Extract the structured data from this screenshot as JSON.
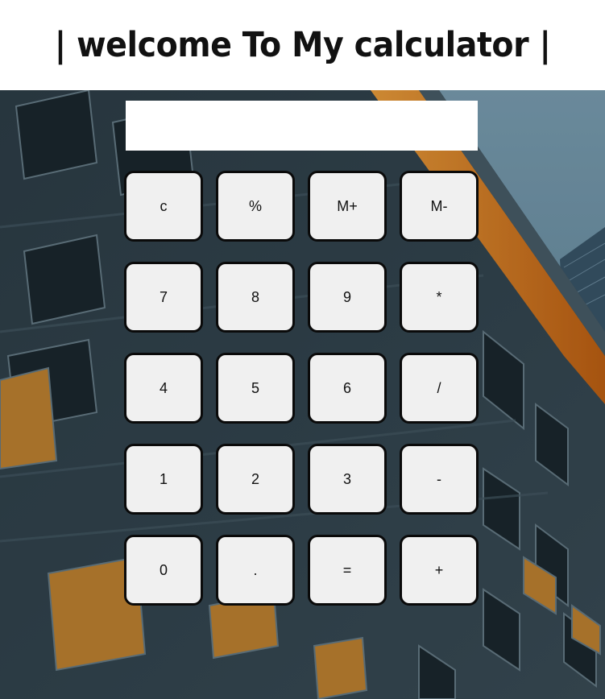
{
  "header": {
    "title": "| welcome To My calculator |"
  },
  "display": {
    "value": "",
    "placeholder": ""
  },
  "keys": [
    [
      "c",
      "%",
      "M+",
      "M-"
    ],
    [
      "7",
      "8",
      "9",
      "*"
    ],
    [
      "4",
      "5",
      "6",
      "/"
    ],
    [
      "1",
      "2",
      "3",
      "-"
    ],
    [
      "0",
      ".",
      "=",
      "+"
    ]
  ],
  "colors": {
    "key_background": "#f0f0f0",
    "key_border": "#0a0a0a",
    "header_background": "#ffffff",
    "accent_orange": "#f08a1c"
  }
}
